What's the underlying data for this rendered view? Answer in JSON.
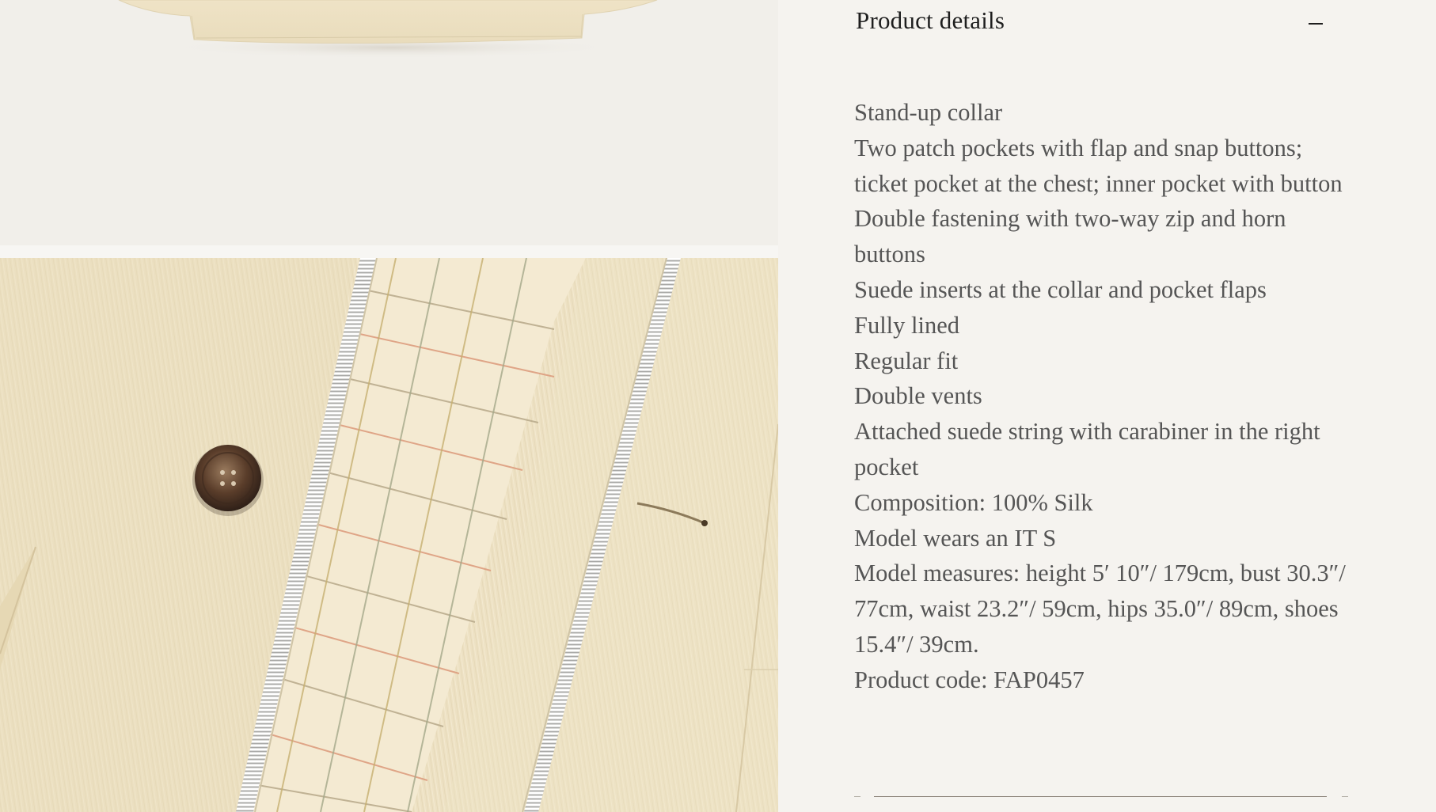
{
  "gallery": {
    "top_image_alt": "Jacket hem",
    "bottom_image_alt": "Jacket front detail"
  },
  "product_details": {
    "title": "Product details",
    "toggle_icon": "minus-icon",
    "items": [
      "Stand-up collar",
      "Two patch pockets with flap and snap buttons; ticket pocket at the chest; inner pocket with button",
      "Double fastening with two-way zip and horn buttons",
      "Suede inserts at the collar and pocket flaps",
      "Fully lined",
      "Regular fit",
      "Double vents",
      "Attached suede string with carabiner in the right pocket",
      "Composition: 100% Silk",
      "Model wears an IT S",
      "Model measures: height 5′ 10″/ 179cm, bust 30.3″/ 77cm, waist 23.2″/ 59cm, hips 35.0″/ 89cm, shoes 15.4″/ 39cm.",
      "Product code: FAP0457"
    ]
  },
  "colors": {
    "background": "#f5f3ef",
    "text": "#555555",
    "title": "#1e1e1e",
    "fabric": "#ede1c3"
  }
}
